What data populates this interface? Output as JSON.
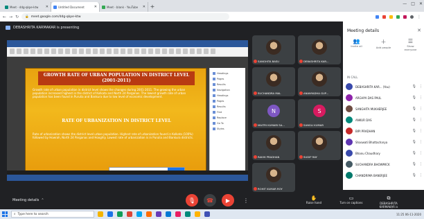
{
  "browser": {
    "tabs": [
      {
        "label": "Meet - ddg-qkpe-ktw",
        "fav": "#00897b",
        "active": false
      },
      {
        "label": "Untitled Document",
        "fav": "#4285f4",
        "active": true
      },
      {
        "label": "Meet - blank - YouTube",
        "fav": "#34a853",
        "active": false
      }
    ],
    "url": "meet.google.com/ddg-qkpe-ktw"
  },
  "meet": {
    "presenting_text": "DEBASHRITA KARMAKAR is presenting",
    "slide": {
      "title_line1": "GROWTH RATE OF URBAN POPULATION IN DISTRICT LEVEL",
      "title_line2": "(2001-2011)",
      "body1": "Growth rate of urban population in district level shows the changes during 2001-2011. The growing the urban population increased highest in the district of Kolkata and North 24 Parganas. The lowest growth rate of urban population has been found in Purulia and Bankura due to low level of economic development.",
      "subtitle": "RATE OF URBANIZATION IN DISTRICT LEVEL",
      "body2": "Rate of urbanization shows the district level urban population. Highest rate of urbanization found in Kolkata (100%) followed by Howrah, North 24 Parganas and Hooghly. Lowest rate of urbanization is in Purulia and Bankura districts."
    },
    "nav_pane": [
      "Headings",
      "Pages",
      "Results",
      "Navigation",
      "Headings",
      "Pages",
      "Results",
      "Find",
      "Replace",
      "Go To",
      "Styles"
    ],
    "tiles": [
      {
        "name": "SANGHITA BASU",
        "kind": "photo",
        "color": "#5f6368"
      },
      {
        "name": "DEBASHRITA KAR...",
        "kind": "photo",
        "color": "#5f6368"
      },
      {
        "name": "SUCHANDRA MAL",
        "kind": "photo",
        "color": "#5f6368"
      },
      {
        "name": "ANANYADHA GUP...",
        "kind": "photo",
        "color": "#5f6368"
      },
      {
        "name": "MAITRI KUMARI SA...",
        "kind": "letter",
        "letter": "N",
        "color": "#7e57c2"
      },
      {
        "name": "SANGLI KUMAR",
        "kind": "letter",
        "letter": "S",
        "color": "#d81b60"
      },
      {
        "name": "RAKHI PRADHAN",
        "kind": "photo",
        "color": "#5f6368"
      },
      {
        "name": "SUDIP RAY",
        "kind": "photo",
        "color": "#5f6368"
      },
      {
        "name": "ROHIT KUMAR ROY",
        "kind": "photo",
        "color": "#5f6368"
      }
    ],
    "meeting_details": "Meeting details",
    "right_tools": [
      {
        "label": "Raise hand",
        "icon": "✋"
      },
      {
        "label": "Turn on captions",
        "icon": "▭"
      },
      {
        "label": "DEBASHRITA KARMAKAR is presenting",
        "icon": "⧉"
      }
    ]
  },
  "panel": {
    "title": "Meeting details",
    "actions": [
      {
        "label": "Invite all",
        "icon": "👥"
      },
      {
        "label": "Add people",
        "icon": "＋"
      },
      {
        "label": "Show everyone",
        "icon": "☰"
      }
    ],
    "section_label": "IN CALL",
    "participants": [
      {
        "name": "DEBASHRITA KAR... (You)",
        "color": "#3949ab"
      },
      {
        "name": "ARGHYA DAS PAUL",
        "color": "#8e24aa"
      },
      {
        "name": "SANGHITA MUKHERJEE",
        "color": "#6d4c41"
      },
      {
        "name": "ANKUR DAS",
        "color": "#00897b"
      },
      {
        "name": "BIPI PRADHAN",
        "color": "#c62828"
      },
      {
        "name": "Shaswati Bhattacharya",
        "color": "#5e35b1"
      },
      {
        "name": "Bhanu Chaudhary",
        "color": "#3949ab"
      },
      {
        "name": "SUCHANDRA BHOWMICK",
        "color": "#455a64"
      },
      {
        "name": "CHANDRIMA BANERJEE",
        "color": "#00796b"
      }
    ]
  },
  "taskbar": {
    "search_placeholder": "Type here to search",
    "clock": "11:25 06-11-2020",
    "apps": [
      "#f4b400",
      "#1a73e8",
      "#0f9d58",
      "#db4437",
      "#00a4ef",
      "#ff6d00",
      "#673ab7",
      "#0078d4",
      "#e91e63",
      "#00897b",
      "#ffb300",
      "#3f51b5"
    ]
  }
}
